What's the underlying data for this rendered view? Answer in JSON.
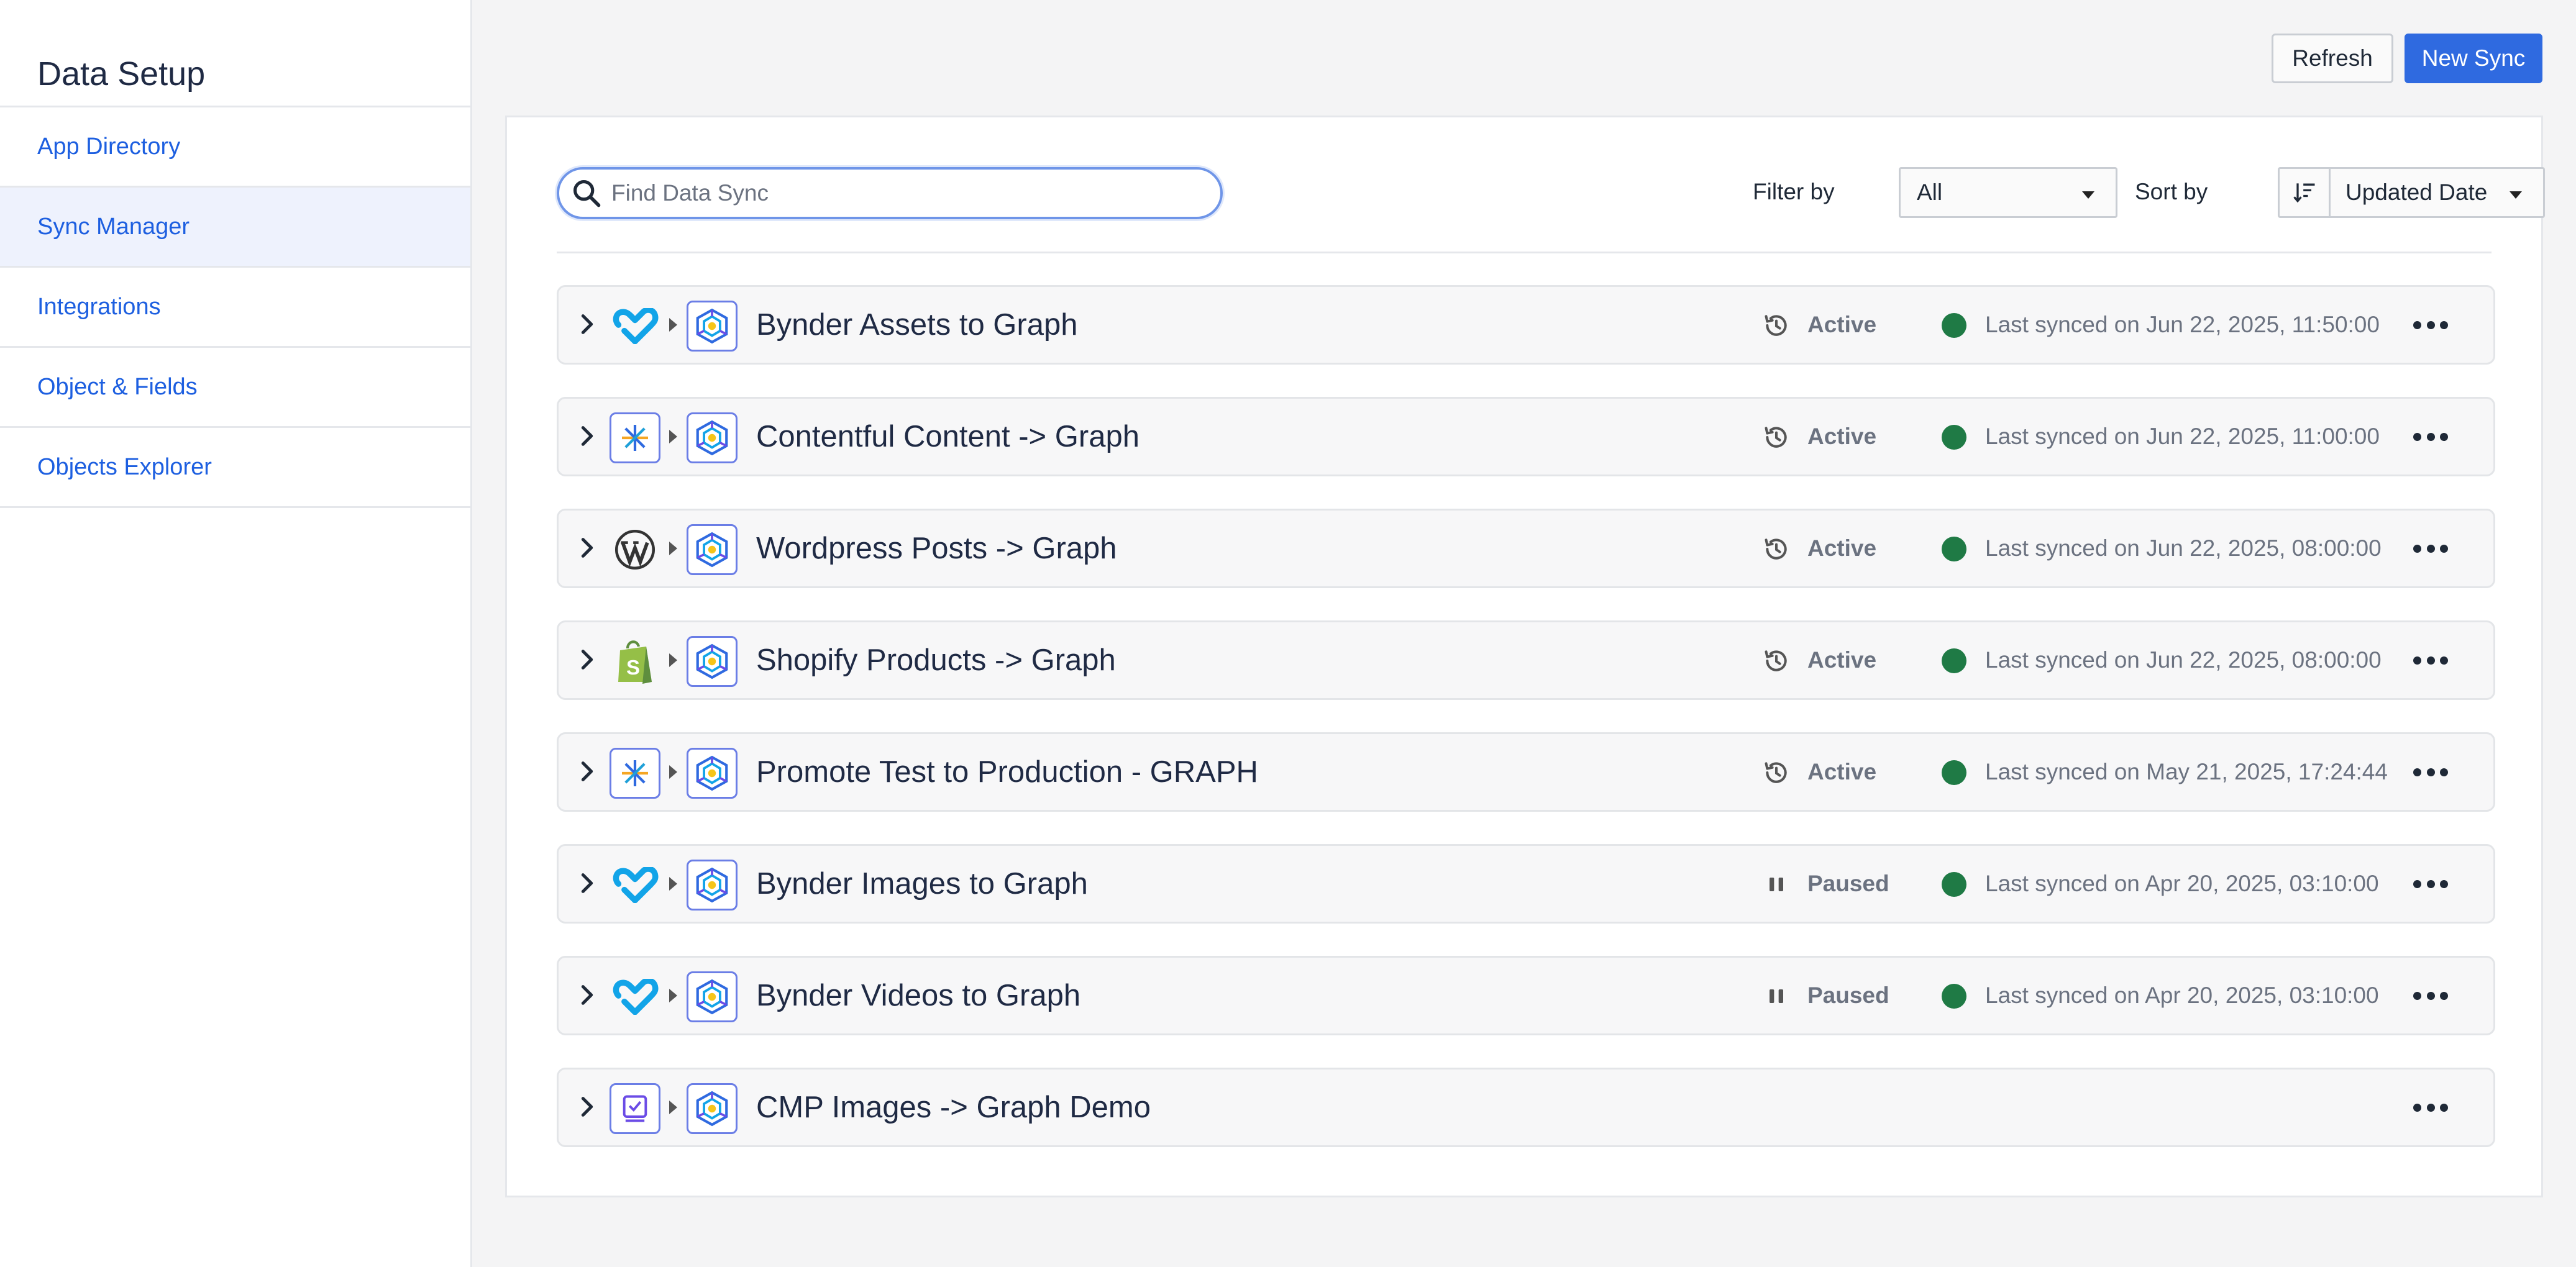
{
  "sidebar": {
    "title": "Data Setup",
    "items": [
      {
        "label": "App Directory",
        "active": false
      },
      {
        "label": "Sync Manager",
        "active": true
      },
      {
        "label": "Integrations",
        "active": false
      },
      {
        "label": "Object & Fields",
        "active": false
      },
      {
        "label": "Objects Explorer",
        "active": false
      }
    ]
  },
  "header": {
    "refresh_label": "Refresh",
    "new_sync_label": "New Sync"
  },
  "toolbar": {
    "search_placeholder": "Find Data Sync",
    "filter_label": "Filter by",
    "filter_value": "All",
    "sort_label": "Sort by",
    "sort_value": "Updated Date"
  },
  "colors": {
    "accent": "#2f6ae0",
    "link": "#1d5fe0",
    "status_ok": "#1f7a45"
  },
  "syncs": [
    {
      "name": "Bynder Assets to Graph",
      "source_icon": "bynder-icon",
      "status": "Active",
      "status_icon": "history-icon",
      "last_synced": "Last synced on Jun 22, 2025, 11:50:00"
    },
    {
      "name": "Contentful Content -> Graph",
      "source_icon": "contentful-icon",
      "status": "Active",
      "status_icon": "history-icon",
      "last_synced": "Last synced on Jun 22, 2025, 11:00:00"
    },
    {
      "name": "Wordpress Posts -> Graph",
      "source_icon": "wordpress-icon",
      "status": "Active",
      "status_icon": "history-icon",
      "last_synced": "Last synced on Jun 22, 2025, 08:00:00"
    },
    {
      "name": "Shopify Products -> Graph",
      "source_icon": "shopify-icon",
      "status": "Active",
      "status_icon": "history-icon",
      "last_synced": "Last synced on Jun 22, 2025, 08:00:00"
    },
    {
      "name": "Promote Test to Production - GRAPH",
      "source_icon": "contentful-icon",
      "status": "Active",
      "status_icon": "history-icon",
      "last_synced": "Last synced on May 21, 2025, 17:24:44"
    },
    {
      "name": "Bynder Images to Graph",
      "source_icon": "bynder-icon",
      "status": "Paused",
      "status_icon": "pause-icon",
      "last_synced": "Last synced on Apr 20, 2025, 03:10:00"
    },
    {
      "name": "Bynder Videos to Graph",
      "source_icon": "bynder-icon",
      "status": "Paused",
      "status_icon": "pause-icon",
      "last_synced": "Last synced on Apr 20, 2025, 03:10:00"
    },
    {
      "name": "CMP Images -> Graph Demo",
      "source_icon": "cmp-icon",
      "status": "",
      "status_icon": "",
      "last_synced": ""
    }
  ]
}
